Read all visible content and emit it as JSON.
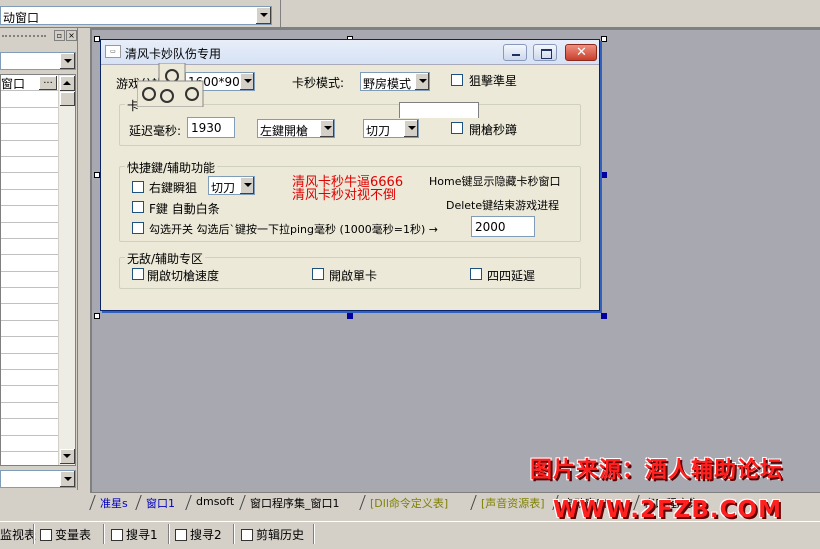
{
  "toolbar": {
    "window_combo": "动窗口"
  },
  "left_panel": {
    "rows": [
      "窗口",
      "",
      "",
      "",
      "",
      "",
      "",
      "",
      "",
      "",
      "",
      "",
      "",
      "",
      "",
      "",
      "",
      "",
      "",
      "",
      "",
      "",
      ""
    ],
    "ellipsis_label": "..."
  },
  "form": {
    "title": "清风卡妙队伤专用",
    "resolution_label": "游戏分辨率:",
    "resolution_value": "1600*900",
    "mode_label": "卡秒模式:",
    "mode_value": "野房模式",
    "sniper_label": "狙擊準星",
    "group1_title": "卡",
    "delay_label": "延迟毫秒:",
    "delay_value": "1930",
    "fire_value": "左鍵開槍",
    "switch_value": "切刀",
    "quick_scope_label": "開槍秒蹲",
    "group2_title": "快捷鍵/辅助功能",
    "rclick_label": "右鍵瞬狙",
    "rclick_value": "切刀",
    "f_label": "F鍵 自動白条",
    "red_line1": "清风卡秒牛逼6666",
    "red_line2": "清风卡秒对视不倒",
    "home_hint": "Home键显示隐藏卡秒窗口",
    "delete_hint": "Delete键结束游戏进程",
    "ping_label": "勾选开关 勾选后`键按一下拉ping毫秒 (1000毫秒=1秒) →",
    "ping_value": "2000",
    "group3_title": "无敌/辅助专区",
    "speed_label": "開啟切槍速度",
    "single_card_label": "開啟單卡",
    "delay44_label": "四四延遲"
  },
  "tabs": [
    {
      "label": "准星s",
      "color": "blue"
    },
    {
      "label": "窗口1",
      "color": "blue"
    },
    {
      "label": "dmsoft",
      "color": "black"
    },
    {
      "label": "窗口程序集_窗口1",
      "color": "black"
    },
    {
      "label": "[Dll命令定义表]",
      "color": "olive"
    },
    {
      "label": "[声音资源表]",
      "color": "olive"
    },
    {
      "label": "启动窗口",
      "color": "black"
    },
    {
      "label": "窗口程序集",
      "color": "black"
    }
  ],
  "bottom_bar": {
    "item1": "监视表",
    "item2": "变量表",
    "item3": "搜寻1",
    "item4": "搜寻2",
    "item5": "剪辑历史"
  },
  "watermark": {
    "line1": "图片来源：酒人辅助论坛",
    "line2": "WWW.2FZB.COM"
  },
  "colors": {
    "accent_red": "#e00000",
    "canvas": "#a8a8b0",
    "form_bg": "#ece9d8"
  }
}
